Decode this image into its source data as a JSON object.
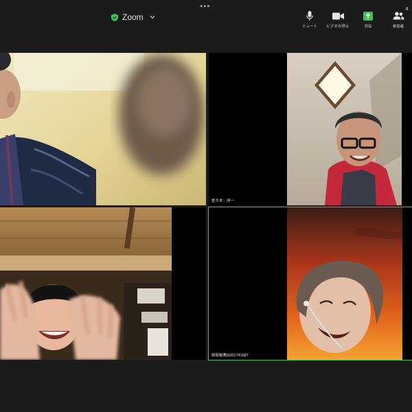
{
  "window": {
    "title": "Zoom",
    "more_label": "•••"
  },
  "controls": {
    "mute": {
      "label": "ミュート",
      "icon": "microphone-icon"
    },
    "video": {
      "label": "ビデオの停止",
      "icon": "video-camera-icon"
    },
    "share": {
      "label": "共有",
      "icon": "share-screen-icon"
    },
    "participants": {
      "label": "参加者",
      "icon": "participants-icon",
      "count": "4"
    }
  },
  "colors": {
    "accent_green": "#3fbe5a",
    "background": "#1b1b1b"
  },
  "tiles": [
    {
      "name": ""
    },
    {
      "name": "佐々木　洋一"
    },
    {
      "name": ""
    },
    {
      "name": "岡部裕美(ID01741587"
    }
  ]
}
